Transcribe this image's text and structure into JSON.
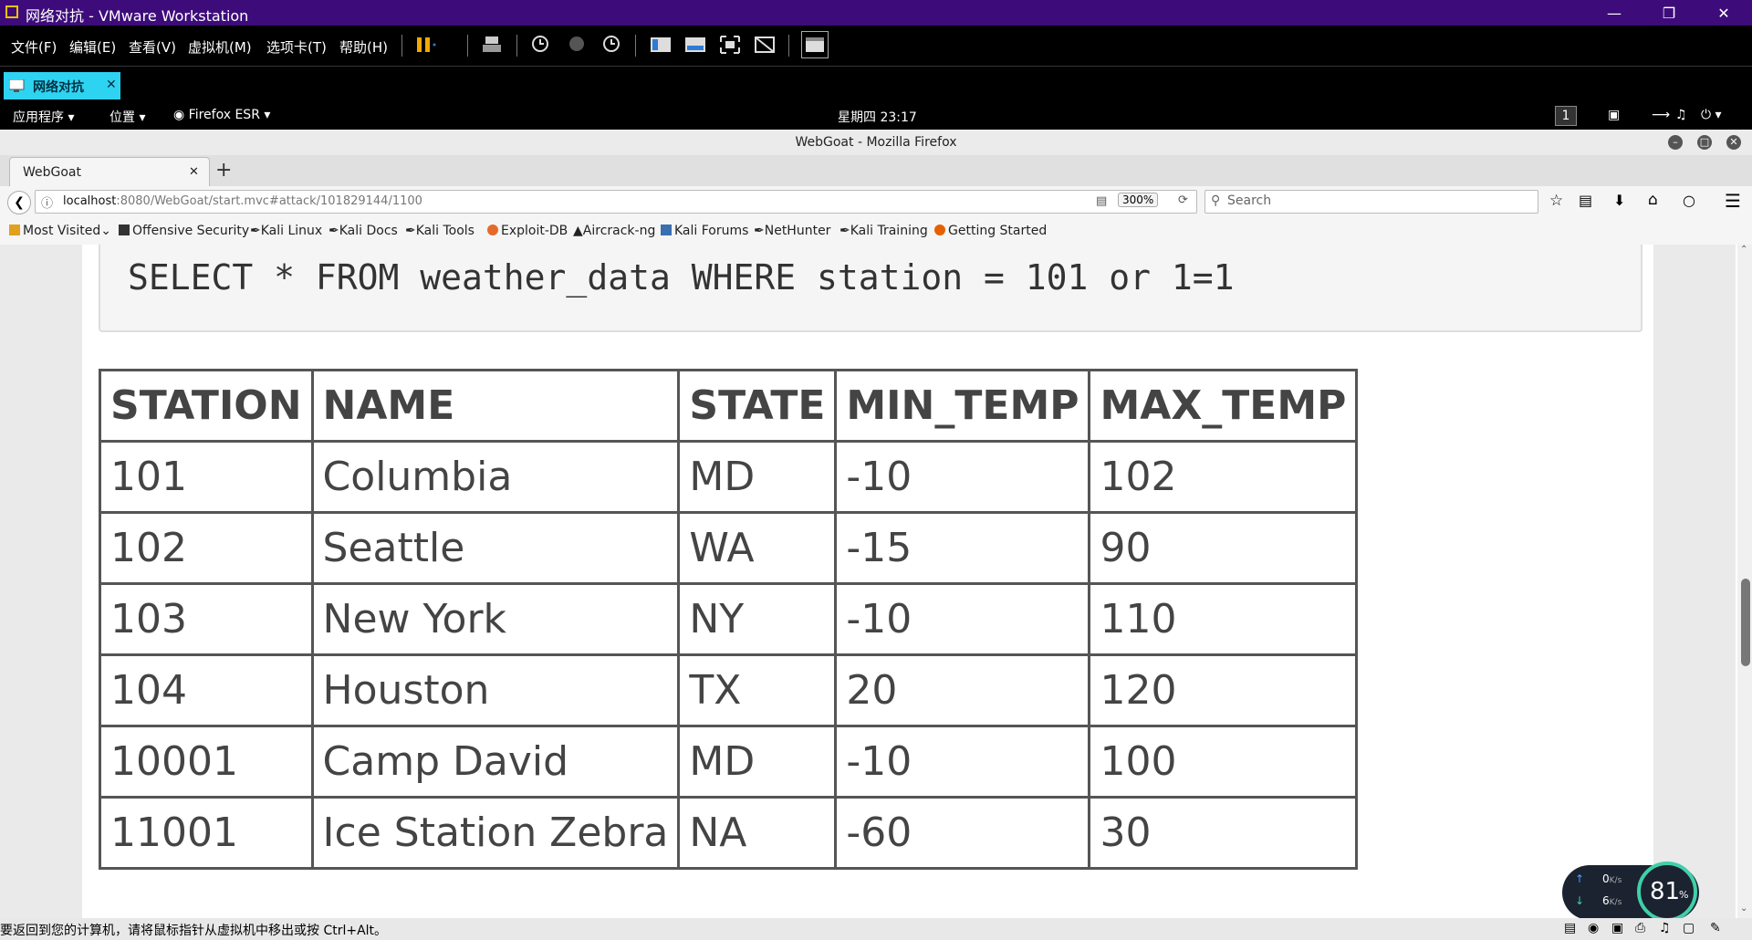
{
  "vm": {
    "title": "网络对抗 - VMware Workstation",
    "menu": [
      "文件(F)",
      "编辑(E)",
      "查看(V)",
      "虚拟机(M)",
      "选项卡(T)",
      "帮助(H)"
    ],
    "tab_label": "网络对抗",
    "status_text": "要返回到您的计算机，请将鼠标指针从虚拟机中移出或按 Ctrl+Alt。"
  },
  "gnome": {
    "apps": "应用程序",
    "places": "位置",
    "browser": "Firefox ESR",
    "clock": "星期四 23:17",
    "workspace": "1"
  },
  "firefox": {
    "window_title": "WebGoat - Mozilla Firefox",
    "tab_title": "WebGoat",
    "url_host": "localhost",
    "url_path": ":8080/WebGoat/start.mvc#attack/101829144/1100",
    "zoom": "300%",
    "search_placeholder": "Search",
    "bookmarks": [
      "Most Visited",
      "Offensive Security",
      "Kali Linux",
      "Kali Docs",
      "Kali Tools",
      "Exploit-DB",
      "Aircrack-ng",
      "Kali Forums",
      "NetHunter",
      "Kali Training",
      "Getting Started"
    ]
  },
  "page": {
    "sql": "SELECT * FROM weather_data WHERE station = 101 or 1=1",
    "table": {
      "headers": [
        "STATION",
        "NAME",
        "STATE",
        "MIN_TEMP",
        "MAX_TEMP"
      ],
      "rows": [
        [
          "101",
          "Columbia",
          "MD",
          "-10",
          "102"
        ],
        [
          "102",
          "Seattle",
          "WA",
          "-15",
          "90"
        ],
        [
          "103",
          "New York",
          "NY",
          "-10",
          "110"
        ],
        [
          "104",
          "Houston",
          "TX",
          "20",
          "120"
        ],
        [
          "10001",
          "Camp David",
          "MD",
          "-10",
          "100"
        ],
        [
          "11001",
          "Ice Station Zebra",
          "NA",
          "-60",
          "30"
        ]
      ]
    }
  },
  "net_widget": {
    "up": "0",
    "up_unit": "K/s",
    "down": "6",
    "down_unit": "K/s",
    "cpu": "81",
    "cpu_unit": "%"
  },
  "colors": {
    "vm_title": "#3d0c7a",
    "tab_accent": "#2fd3f2",
    "widget_ring": "#3fd0a8"
  }
}
